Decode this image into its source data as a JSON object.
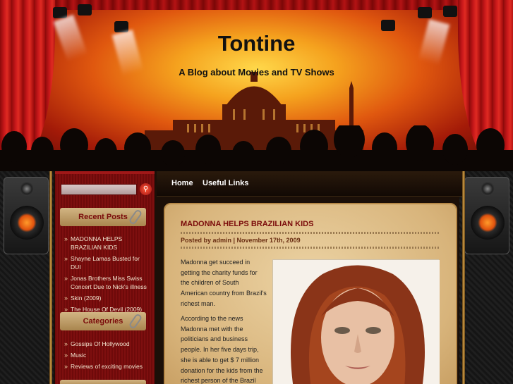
{
  "site": {
    "title": "Tontine",
    "tagline": "A Blog about Movies and TV Shows"
  },
  "nav": {
    "items": [
      {
        "label": "Home"
      },
      {
        "label": "Useful Links"
      }
    ]
  },
  "sidebar": {
    "search": {
      "placeholder": "",
      "button_icon": "magnifier-icon"
    },
    "recent_posts": {
      "title": "Recent Posts",
      "items": [
        "MADONNA HELPS BRAZILIAN KIDS",
        "Shayne Lamas Busted for DUI",
        "Jonas Brothers Miss Swiss Concert Due to Nick's illness",
        "Skin (2009)",
        "The House Of Devil (2009)"
      ]
    },
    "categories": {
      "title": "Categories",
      "items": [
        "Gossips Of Hollywood",
        "Music",
        "Reviews of exciting movies"
      ]
    }
  },
  "post": {
    "title": "MADONNA HELPS BRAZILIAN KIDS",
    "meta": "Posted by admin | November 17th, 2009",
    "paragraphs": [
      "Madonna get succeed in getting the charity funds for the children of South American country from Brazil's richest man.",
      "According to the news Madonna met with the politicians and business people. In her five days trip, she is able to get $ 7 million donation for the kids from the richest person of the Brazil"
    ]
  },
  "colors": {
    "title_red": "#7a0a0a",
    "sidebar_red": "#6e0a0a",
    "content_tan": "#e2c28d"
  }
}
